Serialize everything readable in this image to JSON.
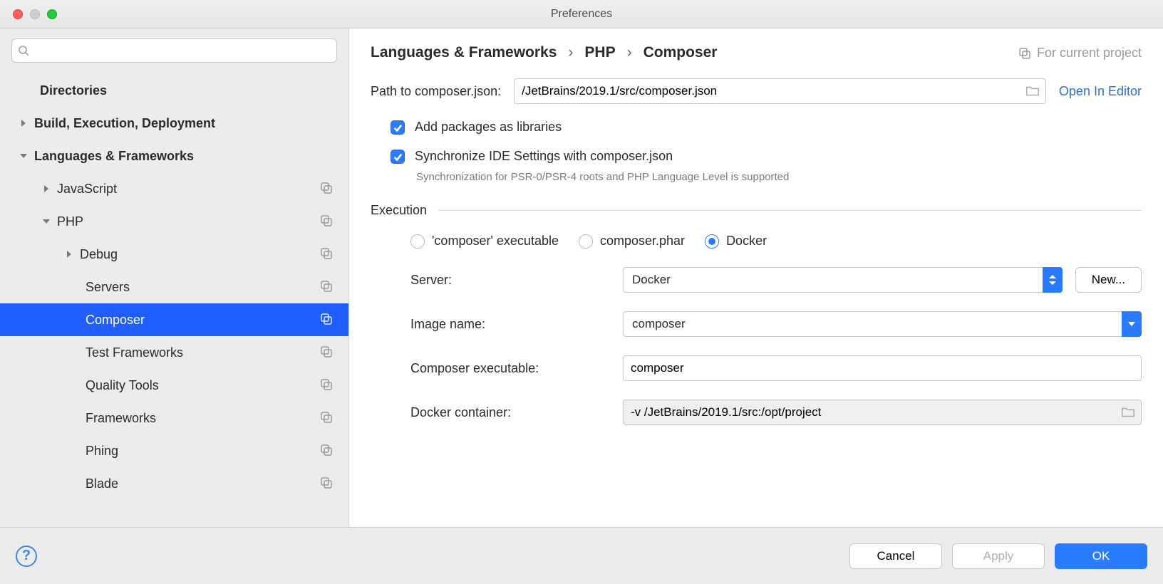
{
  "window": {
    "title": "Preferences"
  },
  "sidebar": {
    "search_placeholder": "",
    "items": {
      "directories": "Directories",
      "build": "Build, Execution, Deployment",
      "langfw": "Languages & Frameworks",
      "javascript": "JavaScript",
      "php": "PHP",
      "debug": "Debug",
      "servers": "Servers",
      "composer": "Composer",
      "test_frameworks": "Test Frameworks",
      "quality_tools": "Quality Tools",
      "frameworks": "Frameworks",
      "phing": "Phing",
      "blade": "Blade"
    }
  },
  "breadcrumbs": {
    "a": "Languages & Frameworks",
    "b": "PHP",
    "c": "Composer",
    "sep": "›"
  },
  "scope": "For current project",
  "form": {
    "path_label": "Path to composer.json:",
    "path_value": "/JetBrains/2019.1/src/composer.json",
    "open_in_editor": "Open In Editor",
    "cb_add_libs": "Add packages as libraries",
    "cb_sync": "Synchronize IDE Settings with composer.json",
    "sync_hint": "Synchronization for PSR-0/PSR-4 roots and PHP Language Level is supported",
    "execution_header": "Execution",
    "radio_exec": "'composer' executable",
    "radio_phar": "composer.phar",
    "radio_docker": "Docker",
    "server_label": "Server:",
    "server_value": "Docker",
    "new_button": "New...",
    "image_label": "Image name:",
    "image_value": "composer",
    "exec_label": "Composer executable:",
    "exec_value": "composer",
    "container_label": "Docker container:",
    "container_value": "-v /JetBrains/2019.1/src:/opt/project"
  },
  "footer": {
    "cancel": "Cancel",
    "apply": "Apply",
    "ok": "OK",
    "help": "?"
  }
}
